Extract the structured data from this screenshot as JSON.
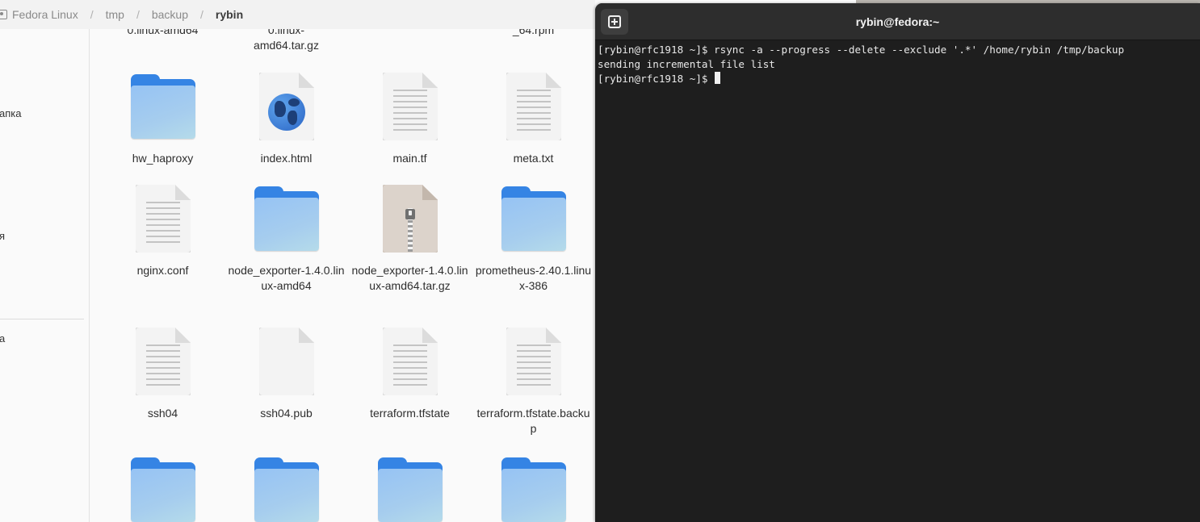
{
  "file_manager": {
    "breadcrumbs": [
      "Fedora Linux",
      "tmp",
      "backup",
      "rybin"
    ],
    "sidebar_fragments": [
      "апка",
      "я",
      "а"
    ],
    "partial_top_labels": [
      "0.linux-amd64",
      "0.linux-\namd64.tar.gz",
      "_64.rpm"
    ],
    "files": [
      {
        "name": "hw_haproxy",
        "type": "folder"
      },
      {
        "name": "index.html",
        "type": "html"
      },
      {
        "name": "main.tf",
        "type": "text"
      },
      {
        "name": "meta.txt",
        "type": "text"
      },
      {
        "name": "nginx.conf",
        "type": "text"
      },
      {
        "name": "node_exporter-1.4.0.linux-amd64",
        "type": "folder"
      },
      {
        "name": "node_exporter-1.4.0.linux-amd64.tar.gz",
        "type": "archive"
      },
      {
        "name": "prometheus-2.40.1.linux-386",
        "type": "folder"
      },
      {
        "name": "ssh04",
        "type": "text"
      },
      {
        "name": "ssh04.pub",
        "type": "blank"
      },
      {
        "name": "terraform.tfstate",
        "type": "text"
      },
      {
        "name": "terraform.tfstate.backup",
        "type": "text"
      },
      {
        "name": "",
        "type": "folder"
      },
      {
        "name": "",
        "type": "folder"
      },
      {
        "name": "",
        "type": "folder"
      },
      {
        "name": "",
        "type": "folder"
      }
    ]
  },
  "terminal": {
    "title": "rybin@fedora:~",
    "new_tab_icon": "new-tab-icon",
    "lines": [
      "[rybin@rfc1918 ~]$ rsync -a --progress --delete --exclude '.*' /home/rybin /tmp/backup",
      "sending incremental file list",
      "[rybin@rfc1918 ~]$ "
    ]
  },
  "colors": {
    "folder_blue": "#3584e4",
    "terminal_bg": "#1e1e1e",
    "header_bg": "#2d2d2d"
  }
}
